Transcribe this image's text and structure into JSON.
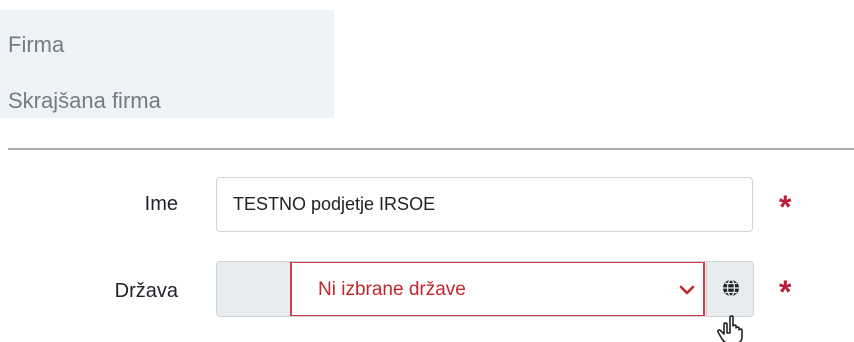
{
  "summary": {
    "firma_label": "Firma",
    "short_firma_label": "Skrajšana firma"
  },
  "form": {
    "name": {
      "label": "Ime",
      "value": "TESTNO podjetje IRSOE",
      "required_mark": "*"
    },
    "country": {
      "label": "Država",
      "selected_value": "Ni izbrane države",
      "required_mark": "*",
      "button_icon": "globe-icon",
      "dropdown_icon": "chevron-down-icon"
    }
  },
  "colors": {
    "summary_background": "#eef3f8",
    "required": "#b91d3a",
    "error_border": "#d93b45",
    "error_text": "#c1272d",
    "addon_background": "#e9ecef"
  },
  "icons": {
    "cursor": "hand-pointer-icon"
  }
}
